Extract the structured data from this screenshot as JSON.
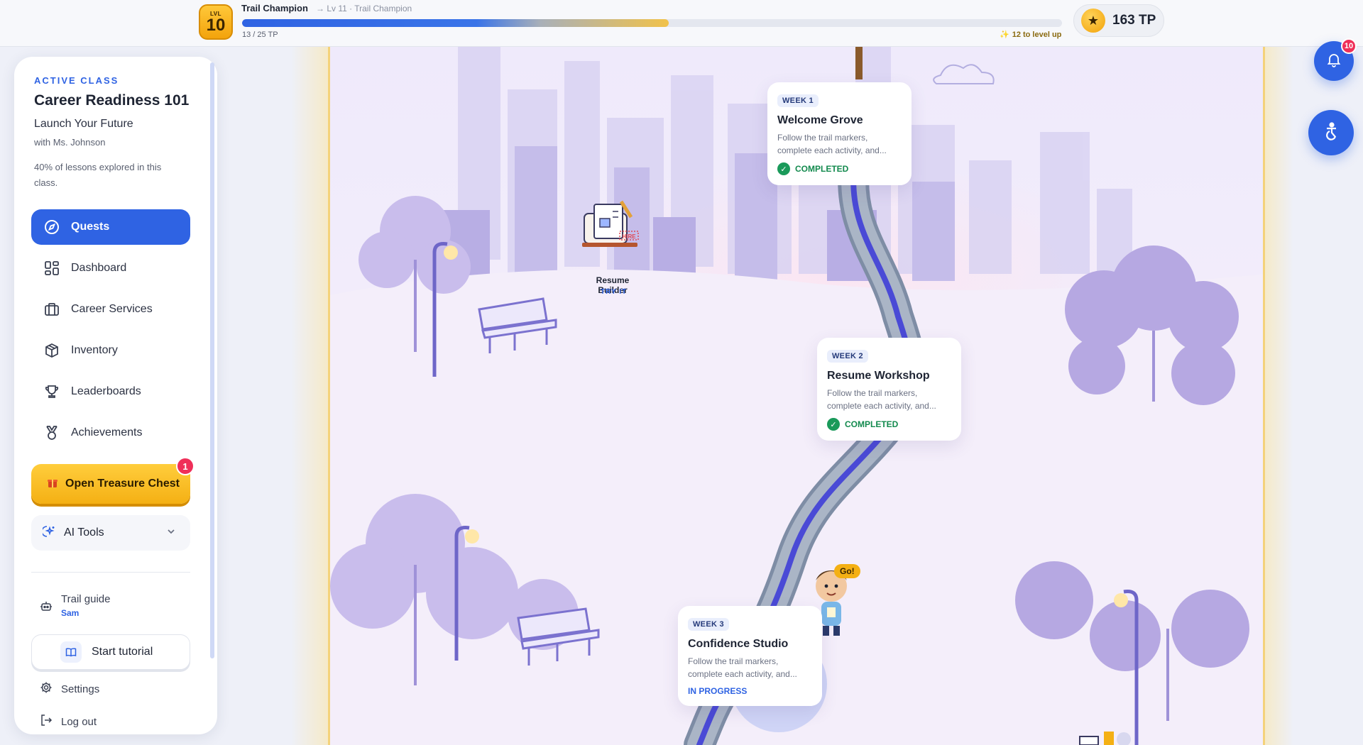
{
  "topbar": {
    "level_label": "LVL",
    "level": "10",
    "rank_title": "Trail Champion",
    "next_rank": "→ Lv 11 · Trail Champion",
    "xp_count": "13 / 25 TP",
    "xp_progress": 0.52,
    "xp_to_level": "12 to level up",
    "tp_total": "163 TP"
  },
  "sidebar": {
    "active_label": "ACTIVE CLASS",
    "class_name": "Career Readiness 101",
    "class_subtitle": "Launch Your Future",
    "teacher": "with Ms. Johnson",
    "progress_text": "40% of lessons explored in this class.",
    "nav": [
      {
        "label": "Quests",
        "icon": "compass-icon",
        "active": true
      },
      {
        "label": "Dashboard",
        "icon": "dashboard-icon",
        "active": false
      },
      {
        "label": "Career Services",
        "icon": "briefcase-icon",
        "active": false
      },
      {
        "label": "Inventory",
        "icon": "box-icon",
        "active": false
      },
      {
        "label": "Leaderboards",
        "icon": "trophy-icon",
        "active": false
      },
      {
        "label": "Achievements",
        "icon": "medal-icon",
        "active": false
      }
    ],
    "treasure_label": "Open Treasure Chest",
    "treasure_count": "1",
    "ai_tools_label": "AI Tools",
    "guide_label": "Trail guide",
    "guide_name": "Sam",
    "tutorial_label": "Start tutorial",
    "settings_label": "Settings",
    "logout_label": "Log out"
  },
  "map": {
    "weeks": [
      {
        "tag": "WEEK 1",
        "title": "Welcome Grove",
        "desc": "Follow the trail markers, complete each activity, and...",
        "status": "COMPLETED"
      },
      {
        "tag": "WEEK 2",
        "title": "Resume Workshop",
        "desc": "Follow the trail markers, complete each activity, and...",
        "status": "COMPLETED"
      },
      {
        "tag": "WEEK 3",
        "title": "Confidence Studio",
        "desc": "Follow the trail markers, complete each activity, and...",
        "status": "IN PROGRESS"
      }
    ],
    "poi_label": "Resume Builder",
    "poi_action": "TRY IT",
    "go_label": "Go!",
    "hire_text": "HIRE"
  },
  "floating": {
    "notification_count": "10"
  },
  "colors": {
    "primary": "#2f63e3",
    "gold": "#f4b014",
    "success": "#1a9a5a",
    "alert": "#ef2f59"
  }
}
